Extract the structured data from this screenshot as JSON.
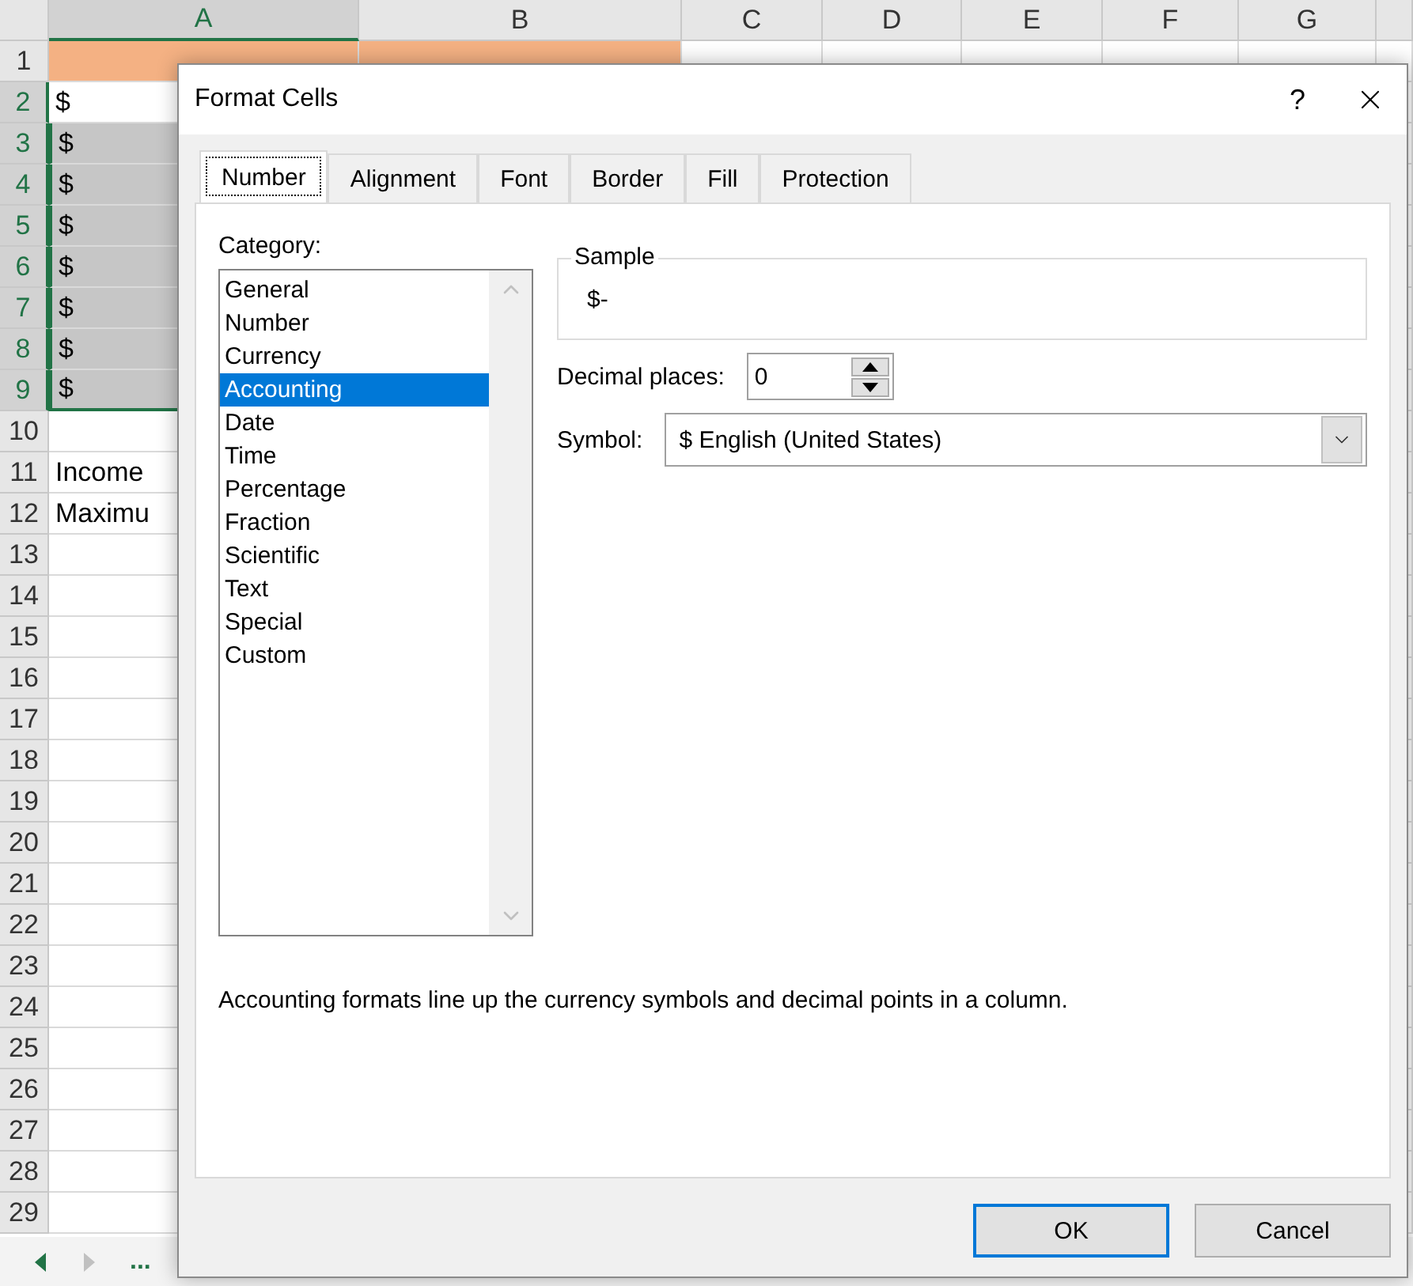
{
  "sheet": {
    "columns": [
      {
        "label": "A",
        "selected": true
      },
      {
        "label": "B",
        "selected": false
      },
      {
        "label": "C",
        "selected": false
      },
      {
        "label": "D",
        "selected": false
      },
      {
        "label": "E",
        "selected": false
      },
      {
        "label": "F",
        "selected": false
      },
      {
        "label": "G",
        "selected": false
      }
    ],
    "rows": [
      {
        "number": "1",
        "selected": false,
        "kind": "header",
        "cells": []
      },
      {
        "number": "2",
        "selected": true,
        "active": true,
        "kind": "data",
        "cells": [
          "$"
        ]
      },
      {
        "number": "3",
        "selected": true,
        "kind": "data",
        "cells": [
          "$"
        ]
      },
      {
        "number": "4",
        "selected": true,
        "kind": "data",
        "cells": [
          "$"
        ]
      },
      {
        "number": "5",
        "selected": true,
        "kind": "data",
        "cells": [
          "$"
        ]
      },
      {
        "number": "6",
        "selected": true,
        "kind": "data",
        "cells": [
          "$"
        ]
      },
      {
        "number": "7",
        "selected": true,
        "kind": "data",
        "cells": [
          "$"
        ]
      },
      {
        "number": "8",
        "selected": true,
        "kind": "data",
        "cells": [
          "$"
        ]
      },
      {
        "number": "9",
        "selected": true,
        "kind": "data",
        "cells": [
          "$"
        ]
      },
      {
        "number": "10",
        "selected": false,
        "kind": "data",
        "cells": []
      },
      {
        "number": "11",
        "selected": false,
        "kind": "data",
        "cells": [
          "Income"
        ]
      },
      {
        "number": "12",
        "selected": false,
        "kind": "data",
        "cells": [
          "Maximu"
        ]
      },
      {
        "number": "13",
        "selected": false,
        "kind": "data",
        "cells": []
      },
      {
        "number": "14",
        "selected": false,
        "kind": "data",
        "cells": []
      },
      {
        "number": "15",
        "selected": false,
        "kind": "data",
        "cells": []
      },
      {
        "number": "16",
        "selected": false,
        "kind": "data",
        "cells": []
      },
      {
        "number": "17",
        "selected": false,
        "kind": "data",
        "cells": []
      },
      {
        "number": "18",
        "selected": false,
        "kind": "data",
        "cells": []
      },
      {
        "number": "19",
        "selected": false,
        "kind": "data",
        "cells": []
      },
      {
        "number": "20",
        "selected": false,
        "kind": "data",
        "cells": []
      },
      {
        "number": "21",
        "selected": false,
        "kind": "data",
        "cells": []
      },
      {
        "number": "22",
        "selected": false,
        "kind": "data",
        "cells": []
      },
      {
        "number": "23",
        "selected": false,
        "kind": "data",
        "cells": []
      },
      {
        "number": "24",
        "selected": false,
        "kind": "data",
        "cells": []
      },
      {
        "number": "25",
        "selected": false,
        "kind": "data",
        "cells": []
      },
      {
        "number": "26",
        "selected": false,
        "kind": "data",
        "cells": []
      },
      {
        "number": "27",
        "selected": false,
        "kind": "data",
        "cells": []
      },
      {
        "number": "28",
        "selected": false,
        "kind": "data",
        "cells": []
      },
      {
        "number": "29",
        "selected": false,
        "kind": "data",
        "cells": []
      }
    ],
    "sheet_nav": {
      "more": "..."
    }
  },
  "dialog": {
    "title": "Format Cells",
    "help": "?",
    "tabs": [
      {
        "label": "Number",
        "selected": true
      },
      {
        "label": "Alignment",
        "selected": false
      },
      {
        "label": "Font",
        "selected": false
      },
      {
        "label": "Border",
        "selected": false
      },
      {
        "label": "Fill",
        "selected": false
      },
      {
        "label": "Protection",
        "selected": false
      }
    ],
    "category_label": "Category:",
    "categories": [
      {
        "label": "General",
        "selected": false
      },
      {
        "label": "Number",
        "selected": false
      },
      {
        "label": "Currency",
        "selected": false
      },
      {
        "label": "Accounting",
        "selected": true
      },
      {
        "label": "Date",
        "selected": false
      },
      {
        "label": "Time",
        "selected": false
      },
      {
        "label": "Percentage",
        "selected": false
      },
      {
        "label": "Fraction",
        "selected": false
      },
      {
        "label": "Scientific",
        "selected": false
      },
      {
        "label": "Text",
        "selected": false
      },
      {
        "label": "Special",
        "selected": false
      },
      {
        "label": "Custom",
        "selected": false
      }
    ],
    "sample": {
      "label": "Sample",
      "value": "$-"
    },
    "decimal_places": {
      "label": "Decimal places:",
      "value": "0"
    },
    "symbol": {
      "label": "Symbol:",
      "value": "$ English (United States)"
    },
    "description": "Accounting formats line up the currency symbols and decimal points in a column.",
    "buttons": [
      {
        "label": "OK",
        "default": true
      },
      {
        "label": "Cancel",
        "default": false
      }
    ]
  }
}
